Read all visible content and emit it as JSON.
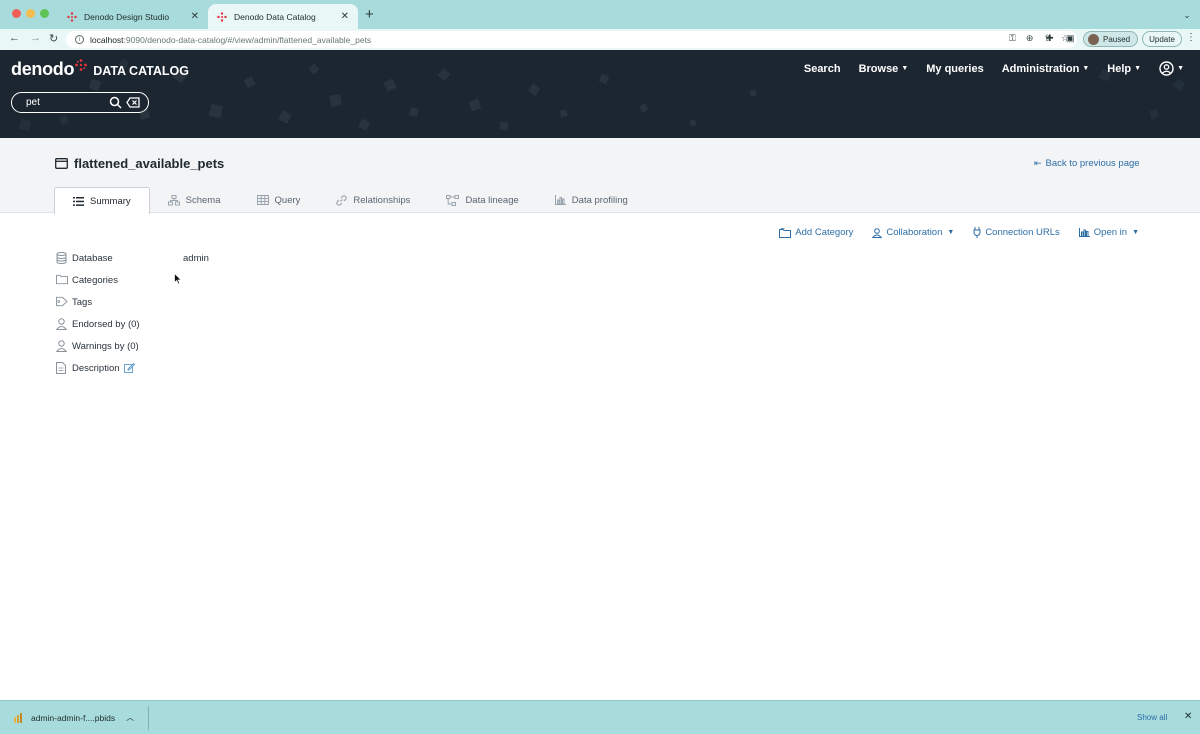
{
  "browser": {
    "tabs": [
      {
        "title": "Denodo Design Studio",
        "active": false
      },
      {
        "title": "Denodo Data Catalog",
        "active": true
      }
    ],
    "url_host": "localhost",
    "url_rest": ":9090/denodo-data-catalog/#/view/admin/flattened_available_pets",
    "profile_label": "Paused",
    "update_label": "Update"
  },
  "header": {
    "logo_word": "denodo",
    "logo_product": "DATA CATALOG",
    "search_value": "pet",
    "nav": [
      {
        "label": "Search",
        "has_caret": false
      },
      {
        "label": "Browse",
        "has_caret": true
      },
      {
        "label": "My queries",
        "has_caret": false
      },
      {
        "label": "Administration",
        "has_caret": true
      },
      {
        "label": "Help",
        "has_caret": true
      }
    ]
  },
  "view": {
    "title": "flattened_available_pets",
    "back_label": "Back to previous page",
    "tabs": [
      {
        "label": "Summary",
        "icon": "list-icon",
        "active": true
      },
      {
        "label": "Schema",
        "icon": "schema-icon",
        "active": false
      },
      {
        "label": "Query",
        "icon": "table-icon",
        "active": false
      },
      {
        "label": "Relationships",
        "icon": "link-icon",
        "active": false
      },
      {
        "label": "Data lineage",
        "icon": "lineage-icon",
        "active": false
      },
      {
        "label": "Data profiling",
        "icon": "bar-chart-icon",
        "active": false
      }
    ],
    "actions": {
      "add_category": "Add Category",
      "collaboration": "Collaboration",
      "connection_urls": "Connection URLs",
      "open_in": "Open in"
    },
    "properties": [
      {
        "label": "Database",
        "value": "admin",
        "icon": "database-icon"
      },
      {
        "label": "Categories",
        "value": "",
        "icon": "folder-icon"
      },
      {
        "label": "Tags",
        "value": "",
        "icon": "tag-icon"
      },
      {
        "label": "Endorsed by (0)",
        "value": "",
        "icon": "user-icon"
      },
      {
        "label": "Warnings by (0)",
        "value": "",
        "icon": "user-icon"
      },
      {
        "label": "Description",
        "value": "",
        "icon": "document-icon"
      }
    ]
  },
  "downloads": {
    "file_name": "admin-admin-f....pbids",
    "show_all": "Show all"
  },
  "colors": {
    "browser_chrome": "#a8dbdc",
    "header_bg": "#1c2630",
    "link_blue": "#2e6ea6",
    "brand_red": "#e0353d"
  }
}
